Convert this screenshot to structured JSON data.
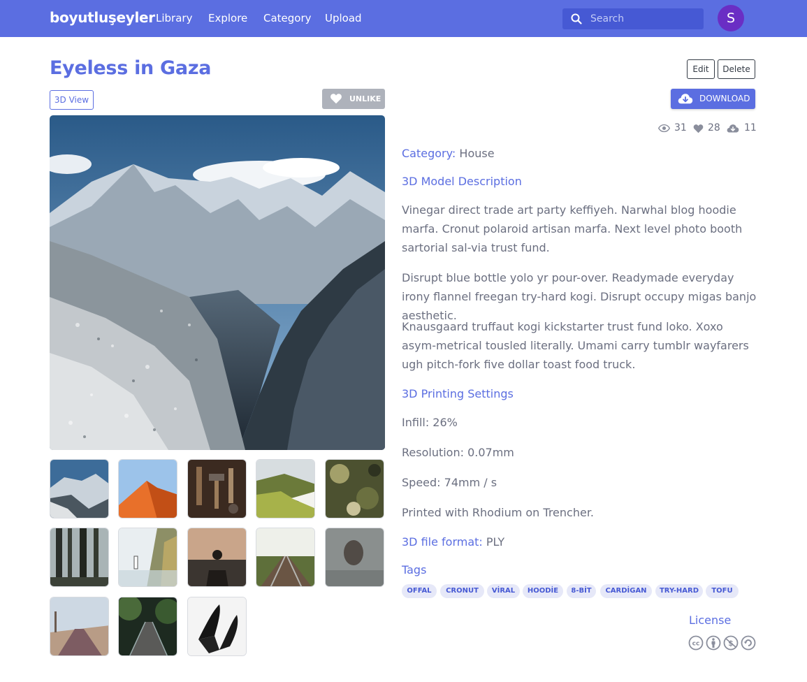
{
  "navbar": {
    "brand": "boyutluşeyler",
    "links": [
      "Library",
      "Explore",
      "Category",
      "Upload"
    ],
    "search_placeholder": "Search",
    "avatar_letter": "S"
  },
  "model": {
    "title": "Eyeless in Gaza",
    "edit_label": "Edit",
    "delete_label": "Delete",
    "view_3d_label": "3D View",
    "unlike_label": "UNLIKE",
    "download_label": "DOWNLOAD",
    "stats": {
      "views": "31",
      "likes": "28",
      "downloads": "11"
    },
    "category_label": "Category:",
    "category_value": "House",
    "description_heading": "3D Model Description",
    "description_paragraphs": [
      "Vinegar direct trade art party keffiyeh. Narwhal blog hoodie marfa. Cronut polaroid artisan marfa. Next level photo booth sartorial sal-via trust fund.",
      "Disrupt blue bottle yolo yr pour-over. Readymade everyday irony flannel freegan try-hard kogi. Disrupt occupy migas banjo aesthetic.",
      "Knausgaard truffaut kogi kickstarter trust fund loko. Xoxo asym-metrical tousled literally. Umami carry tumblr wayfarers ugh pitch-fork five dollar toast food truck."
    ],
    "printing_heading": "3D Printing Settings",
    "infill": "Infill: 26%",
    "resolution": "Resolution: 0.07mm",
    "speed": "Speed: 74mm / s",
    "printed_with": "Printed with Rhodium on Trencher.",
    "file_format_label": "3D file format:",
    "file_format_value": "PLY",
    "tags_heading": "Tags",
    "tags": [
      "OFFAL",
      "CRONUT",
      "VİRAL",
      "HOODİE",
      "8-BİT",
      "CARDİGAN",
      "TRY-HARD",
      "TOFU"
    ],
    "license_heading": "License"
  },
  "icons": {
    "search": "search-icon",
    "heart": "heart-icon",
    "cloud_download": "cloud-download-icon",
    "eye": "eye-icon",
    "license_cc": "cc-icon",
    "license_by": "by-icon",
    "license_nc": "nc-icon",
    "license_sa": "sa-icon"
  },
  "colors": {
    "primary": "#5b6ee1",
    "primary_dark": "#4659d4",
    "avatar": "#6a2ec4",
    "unlike_bg": "#aeb2bb",
    "tag_bg": "#e6e8f8",
    "text": "#6b6f80"
  }
}
